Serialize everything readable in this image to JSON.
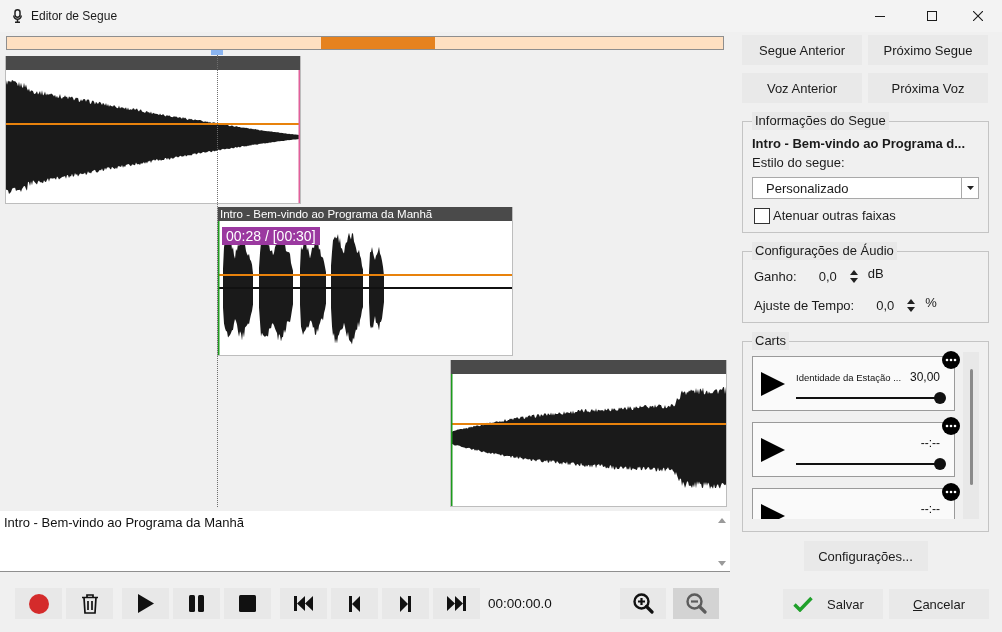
{
  "window": {
    "title": "Editor de Segue"
  },
  "clips": [
    {
      "kind": "fade-out"
    },
    {
      "kind": "voice",
      "title": "Intro - Bem-vindo ao Programa da Manhã",
      "time_badge": "00:28 / [00:30]"
    },
    {
      "kind": "fade-in"
    }
  ],
  "description": "Intro - Bem-vindo ao Programa da Manhã",
  "transport": {
    "buttons": [
      {
        "kind": "record"
      },
      {
        "kind": "delete"
      },
      {
        "kind": "play"
      },
      {
        "kind": "pause"
      },
      {
        "kind": "stop"
      },
      {
        "kind": "first"
      },
      {
        "kind": "previous"
      },
      {
        "kind": "next"
      },
      {
        "kind": "last"
      }
    ],
    "time": "00:00:00.0",
    "zoom_buttons": [
      {
        "kind": "zoom-in",
        "disabled": false
      },
      {
        "kind": "zoom-out",
        "disabled": true
      }
    ]
  },
  "navigation_buttons": [
    "Segue Anterior",
    "Próximo Segue",
    "Voz Anterior",
    "Próxima Voz"
  ],
  "segue_info": {
    "legend": "Informações do Segue",
    "title": "Intro - Bem-vindo ao Programa d...",
    "style_label": "Estilo do segue:",
    "style_value": "Personalizado",
    "attenuate": {
      "label": "Atenuar outras faixas",
      "checked": false
    }
  },
  "audio_settings": {
    "legend": "Configurações de Áudio",
    "rows": [
      {
        "label": "Ganho:",
        "value": "0,0",
        "unit": "dB"
      },
      {
        "label": "Ajuste de Tempo:",
        "value": "0,0",
        "unit": "%"
      }
    ]
  },
  "carts": {
    "legend": "Carts",
    "items": [
      {
        "name": "Identidade da Estação ...",
        "time": "30,00",
        "level": 1
      },
      {
        "time": "--:--",
        "level": 1
      },
      {
        "time": "--:--"
      }
    ]
  },
  "settings_button": "Configurações...",
  "dialog_buttons": {
    "save": "Salvar",
    "cancel": "Cancelar"
  }
}
